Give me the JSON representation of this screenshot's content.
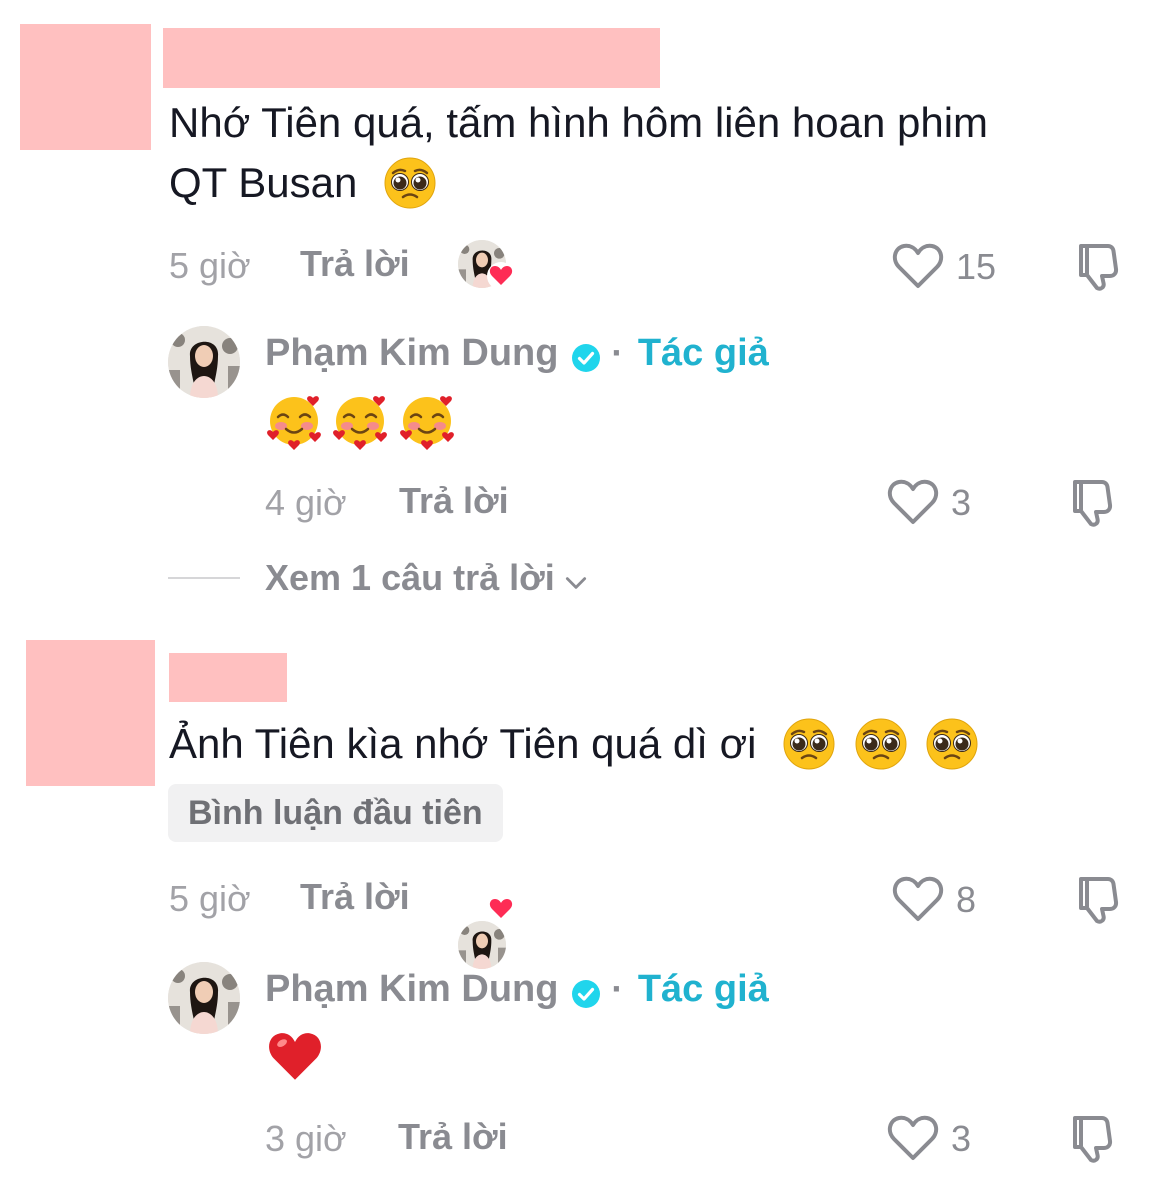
{
  "comments": [
    {
      "text_line1": "Nhớ Tiên quá, tấm hình hôm liên hoan phim",
      "text_line2": "QT Busan",
      "time": "5 giờ",
      "reply_label": "Trả lời",
      "likes": "15",
      "reply": {
        "author": "Phạm Kim Dung",
        "separator": "·",
        "badge": "Tác giả",
        "time": "4 giờ",
        "reply_label": "Trả lời",
        "likes": "3"
      },
      "view_more": "Xem 1 câu trả lời"
    },
    {
      "text": "Ảnh Tiên kìa nhớ Tiên quá dì ơi",
      "pill": "Bình luận đầu tiên",
      "time": "5 giờ",
      "reply_label": "Trả lời",
      "likes": "8",
      "reply": {
        "author": "Phạm Kim Dung",
        "separator": "·",
        "badge": "Tác giả",
        "time": "3 giờ",
        "reply_label": "Trả lời",
        "likes": "3"
      }
    }
  ],
  "colors": {
    "redaction": "#ffc0c0",
    "author_badge": "#20b2cf",
    "verified": "#20d5ec",
    "heart_badge": "#fe2c55",
    "red_heart": "#e0202a"
  },
  "icons": [
    "pleading-face-icon",
    "smiling-face-hearts-icon",
    "red-heart-icon",
    "verified-icon",
    "heart-outline-icon",
    "dislike-icon",
    "chevron-down-icon"
  ]
}
